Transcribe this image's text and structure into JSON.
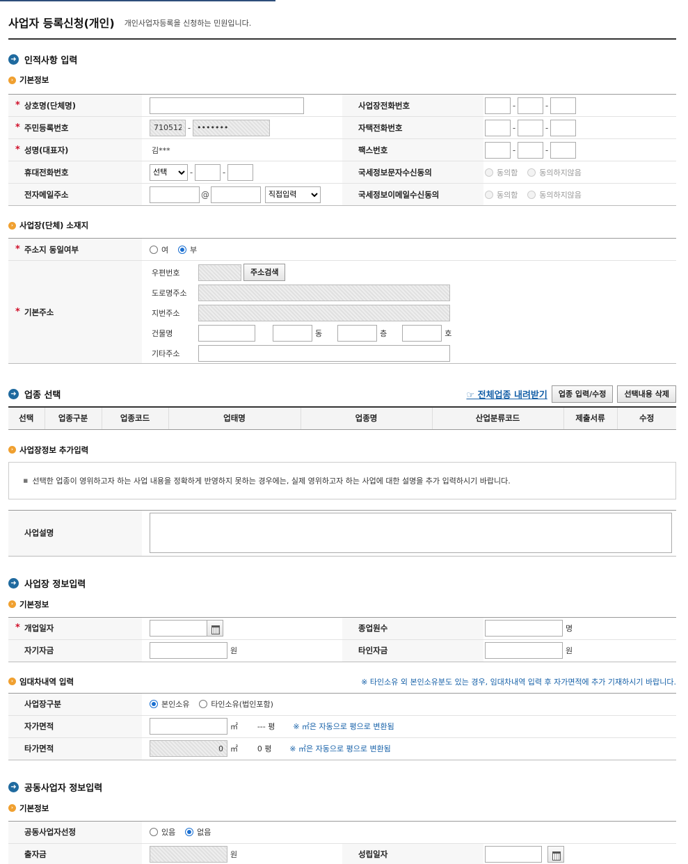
{
  "page": {
    "title": "사업자 등록신청(개인)",
    "description": "개인사업자등록을 신청하는 민원입니다."
  },
  "personal": {
    "section_title": "인적사항 입력",
    "sub_basic": "기본정보",
    "labels": {
      "trade_name": "상호명(단체명)",
      "resident_no": "주민등록번호",
      "name": "성명(대표자)",
      "mobile": "휴대전화번호",
      "email": "전자메일주소",
      "biz_phone": "사업장전화번호",
      "home_phone": "자택전화번호",
      "fax": "팩스번호",
      "sms_consent": "국세정보문자수신동의",
      "email_consent": "국세정보이메일수신동의"
    },
    "values": {
      "resident_front": "710512",
      "resident_back": "•••••••",
      "name": "김***",
      "mobile_select": "선택",
      "email_at": "@",
      "email_domain_select": "직접입력"
    },
    "consent": {
      "agree": "동의함",
      "disagree": "동의하지않음"
    }
  },
  "address": {
    "sub_title": "사업장(단체) 소재지",
    "same_label": "주소지 동일여부",
    "same_yes": "여",
    "same_no": "부",
    "basic_label": "기본주소",
    "postal": "우편번호",
    "search_button": "주소검색",
    "road": "도로명주소",
    "lot": "지번주소",
    "building": "건물명",
    "dong": "동",
    "floor": "층",
    "ho": "호",
    "etc": "기타주소"
  },
  "industry": {
    "section_title": "업종 선택",
    "download_link": "☞ 전체업종 내려받기",
    "edit_button": "업종 입력/수정",
    "delete_button": "선택내용 삭제",
    "columns": [
      "선택",
      "업종구분",
      "업종코드",
      "업태명",
      "업종명",
      "산업분류코드",
      "제출서류",
      "수정"
    ],
    "extra_sub_title": "사업장정보 추가입력",
    "info_text": "선택한 업종이 영위하고자 하는 사업 내용을 정확하게 반영하지 못하는 경우에는, 실제 영위하고자 하는 사업에 대한 설명을 추가 입력하시기 바랍니다.",
    "desc_label": "사업설명"
  },
  "business": {
    "section_title": "사업장 정보입력",
    "sub_basic": "기본정보",
    "open_date": "개업일자",
    "employees": "종업원수",
    "employees_unit": "명",
    "own_fund": "자기자금",
    "other_fund": "타인자금",
    "won": "원",
    "lease_sub": "임대차내역 입력",
    "lease_note": "※ 타인소유 외 본인소유분도 있는 경우, 임대차내역 입력 후 자가면적에 추가 기재하시기 바랍니다.",
    "biz_type_label": "사업장구분",
    "own": "본인소유",
    "others": "타인소유(법인포함)",
    "own_area": "자가면적",
    "other_area": "타가면적",
    "sqm": "㎡",
    "pyeong_own": "--- 평",
    "pyeong_other": "0 평",
    "other_area_value": "0",
    "convert_note": "※ ㎡은 자동으로 평으로 변환됨"
  },
  "joint": {
    "section_title": "공동사업자 정보입력",
    "sub_basic": "기본정보",
    "select_label": "공동사업자선정",
    "yes": "있음",
    "no": "없음",
    "investment": "출자금",
    "won": "원",
    "est_date": "성립일자"
  }
}
